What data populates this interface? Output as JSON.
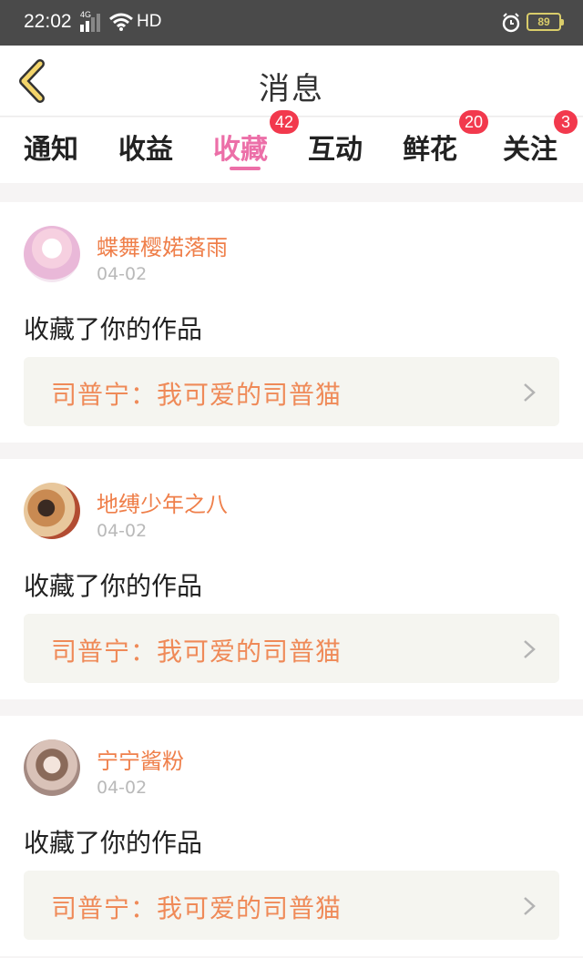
{
  "status_bar": {
    "time": "22:02",
    "network": "4G",
    "hd": "HD",
    "battery": "89"
  },
  "header": {
    "title": "消息",
    "back_icon": "chevron-left-icon"
  },
  "tabs": [
    {
      "label": "通知"
    },
    {
      "label": "收益"
    },
    {
      "label": "收藏",
      "badge": "42",
      "active": true
    },
    {
      "label": "互动"
    },
    {
      "label": "鲜花",
      "badge": "20"
    },
    {
      "label": "关注",
      "badge": "3"
    }
  ],
  "messages": [
    {
      "user": "蝶舞樱婼落雨",
      "date": "04-02",
      "action": "收藏了你的作品",
      "work": "司普宁：我可爱的司普猫"
    },
    {
      "user": "地缚少年之八",
      "date": "04-02",
      "action": "收藏了你的作品",
      "work": "司普宁：我可爱的司普猫"
    },
    {
      "user": "宁宁酱粉",
      "date": "04-02",
      "action": "收藏了你的作品",
      "work": "司普宁：我可爱的司普猫"
    }
  ],
  "colors": {
    "accent_pink": "#ec6fa8",
    "username_orange": "#ef7f4a",
    "badge_red": "#f2394d",
    "status_bar": "#4a4a4a"
  }
}
